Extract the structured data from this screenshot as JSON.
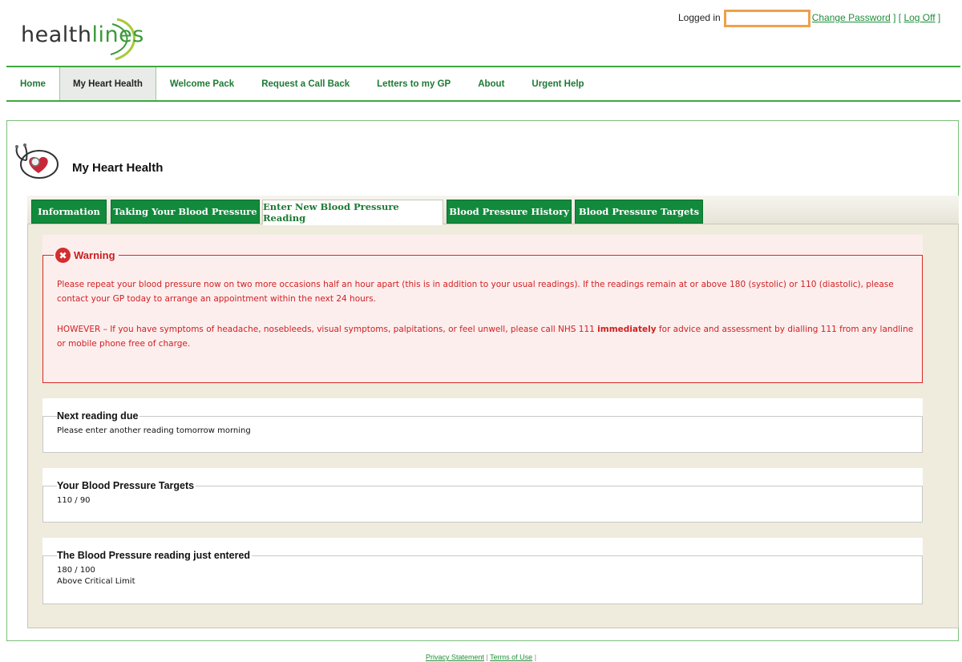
{
  "header": {
    "logo_text_1": "health",
    "logo_text_2": "lines",
    "logged_in_label": "Logged in",
    "change_password_label": "Change Password",
    "log_off_label": "Log Off",
    "bracket_mid": " ] [ ",
    "bracket_end": " ]"
  },
  "nav": {
    "items": [
      {
        "label": "Home"
      },
      {
        "label": "My Heart Health"
      },
      {
        "label": "Welcome Pack"
      },
      {
        "label": "Request a Call Back"
      },
      {
        "label": "Letters to my GP"
      },
      {
        "label": "About"
      },
      {
        "label": "Urgent Help"
      }
    ],
    "active_index": 1
  },
  "page": {
    "title": "My Heart Health"
  },
  "tabs": [
    {
      "label": "Information"
    },
    {
      "label": "Taking Your Blood Pressure"
    },
    {
      "label": "Enter New Blood Pressure Reading"
    },
    {
      "label": "Blood Pressure History"
    },
    {
      "label": "Blood Pressure Targets"
    }
  ],
  "active_tab": 2,
  "warning": {
    "title": "Warning",
    "icon_glyph": "✖",
    "para1": "Please repeat your blood pressure now on two more occasions half an hour apart (this is in addition to your usual readings). If the readings remain at or above 180 (systolic) or 110 (diastolic), please contact your GP today to arrange an appointment within the next 24 hours.",
    "para2_before": "HOWEVER – If you have symptoms of headache, nosebleeds, visual symptoms, palpitations, or feel unwell, please call NHS 111 ",
    "para2_bold": "immediately",
    "para2_after": " for advice and assessment by dialling 111 from any landline or mobile phone free of charge."
  },
  "next_reading": {
    "title": "Next reading due",
    "text": "Please enter another reading tomorrow morning"
  },
  "targets": {
    "title": "Your Blood Pressure Targets",
    "value": "110 / 90"
  },
  "reading": {
    "title": "The Blood Pressure reading just entered",
    "value": "180 / 100",
    "status": "Above Critical Limit"
  },
  "footer": {
    "privacy": "Privacy Statement",
    "sep": " | ",
    "terms": "Terms of Use",
    "trail": " |"
  },
  "colors": {
    "brand_green": "#128a3c",
    "warning_red": "#d12020",
    "login_highlight": "#f0a04b"
  }
}
